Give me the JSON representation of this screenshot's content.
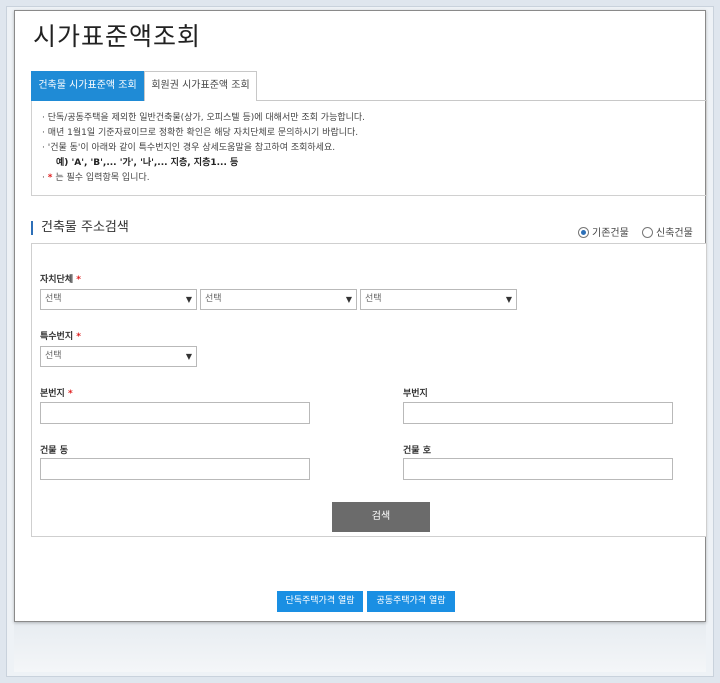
{
  "page": {
    "title": "시가표준액조회"
  },
  "tabs": [
    {
      "label": "건축물 시가표준액 조회",
      "active": true
    },
    {
      "label": "회원권 시가표준액 조회",
      "active": false
    }
  ],
  "notice": {
    "lines": [
      "· 단독/공동주택을 제외한 일반건축물(상가, 오피스텔 등)에 대해서만 조회 가능합니다.",
      "· 매년 1월1일 기준자료이므로 정확한 확인은 해당 자치단체로 문의하시기 바랍니다.",
      "· '건물 동'이 아래와 같이 특수번지인 경우 상세도움말을 참고하여 조회하세요."
    ],
    "example": "예) 'A', 'B',... '가', '나',... 지층, 지층1... 등",
    "required_prefix": "·",
    "required_mark": "*",
    "required_text": "는 필수 입력항목 입니다."
  },
  "section": {
    "title": "건축물 주소검색"
  },
  "radios": [
    {
      "label": "기존건물",
      "checked": true
    },
    {
      "label": "신축건물",
      "checked": false
    }
  ],
  "form": {
    "required_mark": "*",
    "jachi_label": "자치단체",
    "jachi_selects": [
      "선택",
      "선택",
      "선택"
    ],
    "teuksu_label": "특수번지",
    "teuksu_select": "선택",
    "bonbunji_label": "본번지",
    "bubunji_label": "부번지",
    "dong_label": "건물 동",
    "ho_label": "건물 호",
    "bonbunji_value": "",
    "bubunji_value": "",
    "dong_value": "",
    "ho_value": "",
    "search_label": "검색"
  },
  "bottom_buttons": [
    "단독주택가격 열람",
    "공동주택가격 열람"
  ],
  "colors": {
    "accent": "#1f8bd6",
    "button_dark": "#6b6b6b",
    "required": "#e02020"
  }
}
